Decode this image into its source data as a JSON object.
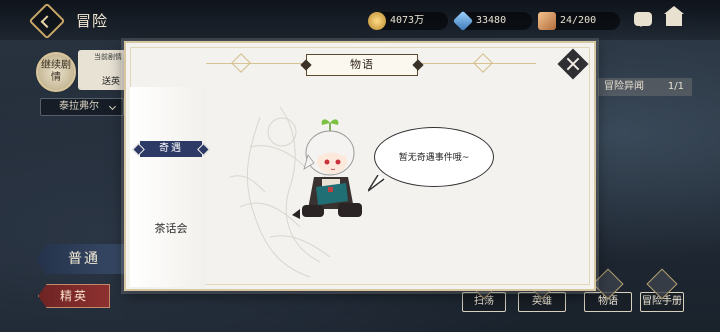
{
  "topbar": {
    "title": "冒险",
    "resources": [
      {
        "icon": "gold-coin-icon",
        "value": "4073万"
      },
      {
        "icon": "gem-icon",
        "value": "33480"
      },
      {
        "icon": "stamina-icon",
        "value": "24/200"
      }
    ]
  },
  "left_panel": {
    "continue_story": "继续剧情",
    "story_card_title": "当前剧情",
    "story_card_sub": "送英",
    "location": "泰拉弗尔",
    "mode_normal": "普通",
    "mode_elite": "精英"
  },
  "right_panel": {
    "adventure_space_label": "冒险异闻",
    "adventure_space_count": "1/1",
    "bottom_buttons": [
      "扫荡",
      "英雄",
      "物语",
      "冒险手册"
    ]
  },
  "modal": {
    "title": "物语",
    "tabs": [
      {
        "label": "奇遇",
        "active": true
      },
      {
        "label": "茶话会",
        "active": false
      }
    ],
    "empty_message": "暂无奇遇事件哦~"
  },
  "colors": {
    "accent_gold": "#d7c7a0",
    "tab_active_bg": "#2d3a66",
    "modal_bg": "#f4f2ee"
  }
}
